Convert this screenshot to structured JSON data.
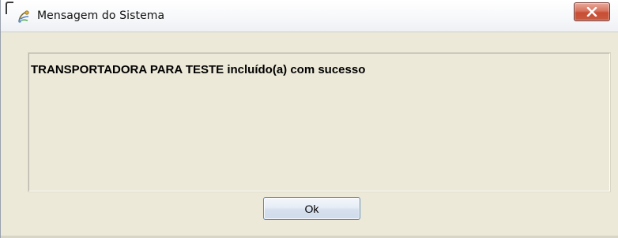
{
  "window": {
    "title": "Mensagem do Sistema",
    "close_symbol": "X"
  },
  "message": {
    "text": "TRANSPORTADORA PARA TESTE incluído(a) com sucesso"
  },
  "buttons": {
    "ok_label": "Ok"
  },
  "icons": {
    "app": "system-message-icon",
    "close": "close-icon"
  },
  "colors": {
    "dialog_background": "#ece9d8",
    "close_button": "#c74d34",
    "ok_button_border": "#5c88b8"
  }
}
